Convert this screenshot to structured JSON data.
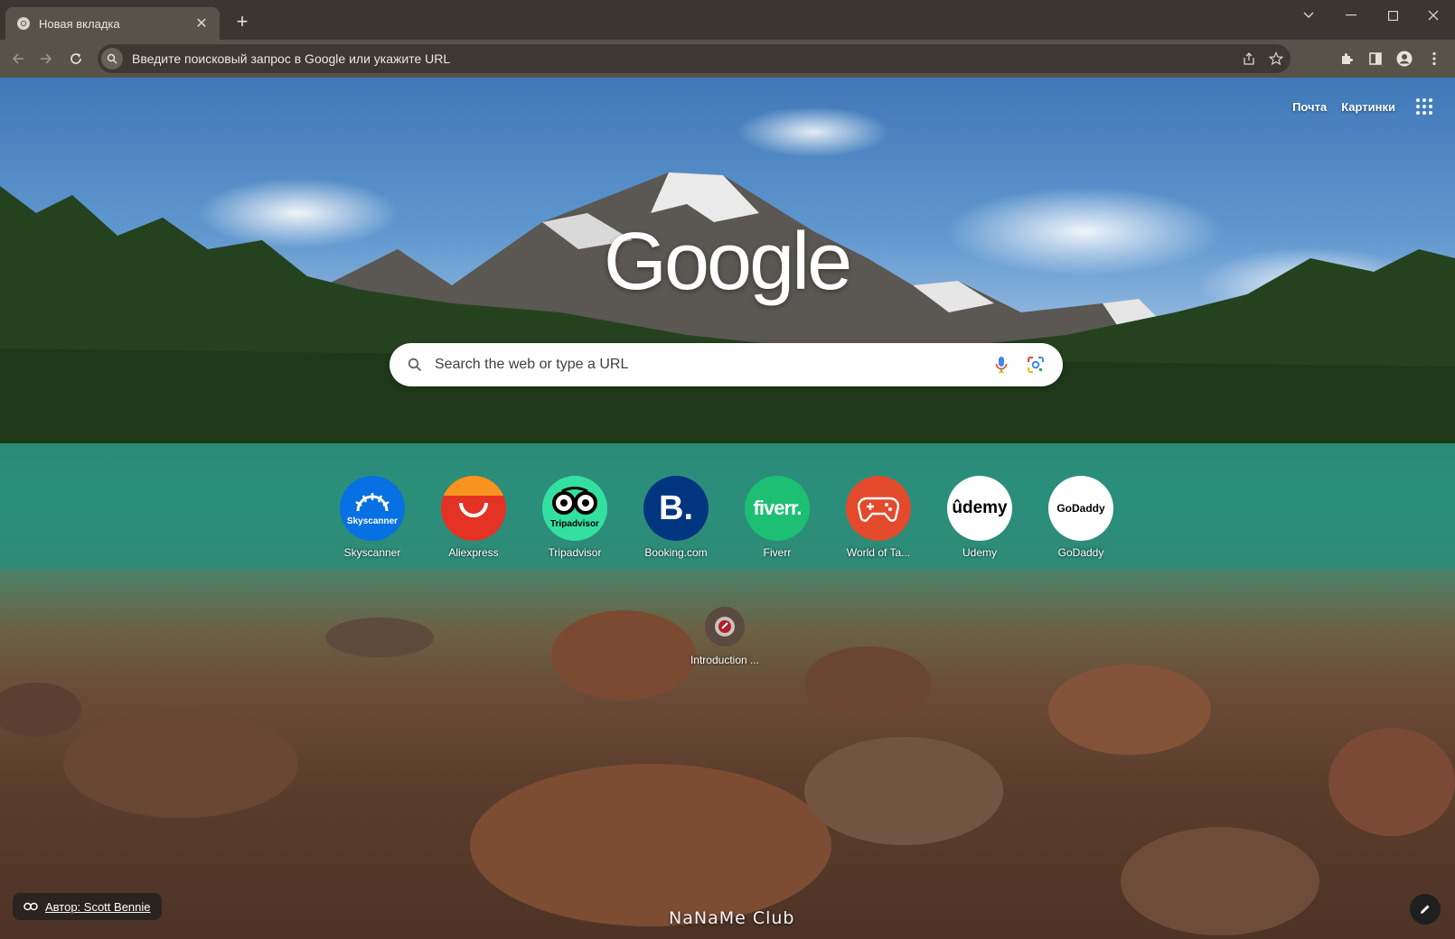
{
  "browser": {
    "tab": {
      "title": "Новая вкладка",
      "close_icon": "close-icon",
      "favicon": "chrome-icon"
    },
    "new_tab_label": "+",
    "omnibox": {
      "text": "Введите поисковый запрос в Google или укажите URL"
    }
  },
  "ntp": {
    "top_links": {
      "mail": "Почта",
      "images": "Картинки"
    },
    "logo": "Google",
    "search": {
      "placeholder": "Search the web or type a URL"
    },
    "shortcuts": [
      {
        "label": "Skyscanner",
        "icon_text": "Skyscanner",
        "color": "#0770e3"
      },
      {
        "label": "Aliexpress",
        "icon_text": "",
        "color": "#e43225"
      },
      {
        "label": "Tripadvisor",
        "icon_text": "Tripadvisor",
        "color": "#34e0a1"
      },
      {
        "label": "Booking.com",
        "icon_text": "B.",
        "color": "#003580"
      },
      {
        "label": "Fiverr",
        "icon_text": "fiverr.",
        "color": "#1dbf73"
      },
      {
        "label": "World of Ta...",
        "icon_text": "",
        "color": "#e24a2b"
      },
      {
        "label": "Udemy",
        "icon_text": "ûdemy",
        "color": "#ffffff"
      },
      {
        "label": "GoDaddy",
        "icon_text": "GoDaddy",
        "color": "#ffffff"
      }
    ],
    "intro_tile": {
      "label": "Introduction ..."
    },
    "attribution": "Автор: Scott Bennie",
    "watermark": "NaNaMe Club"
  }
}
